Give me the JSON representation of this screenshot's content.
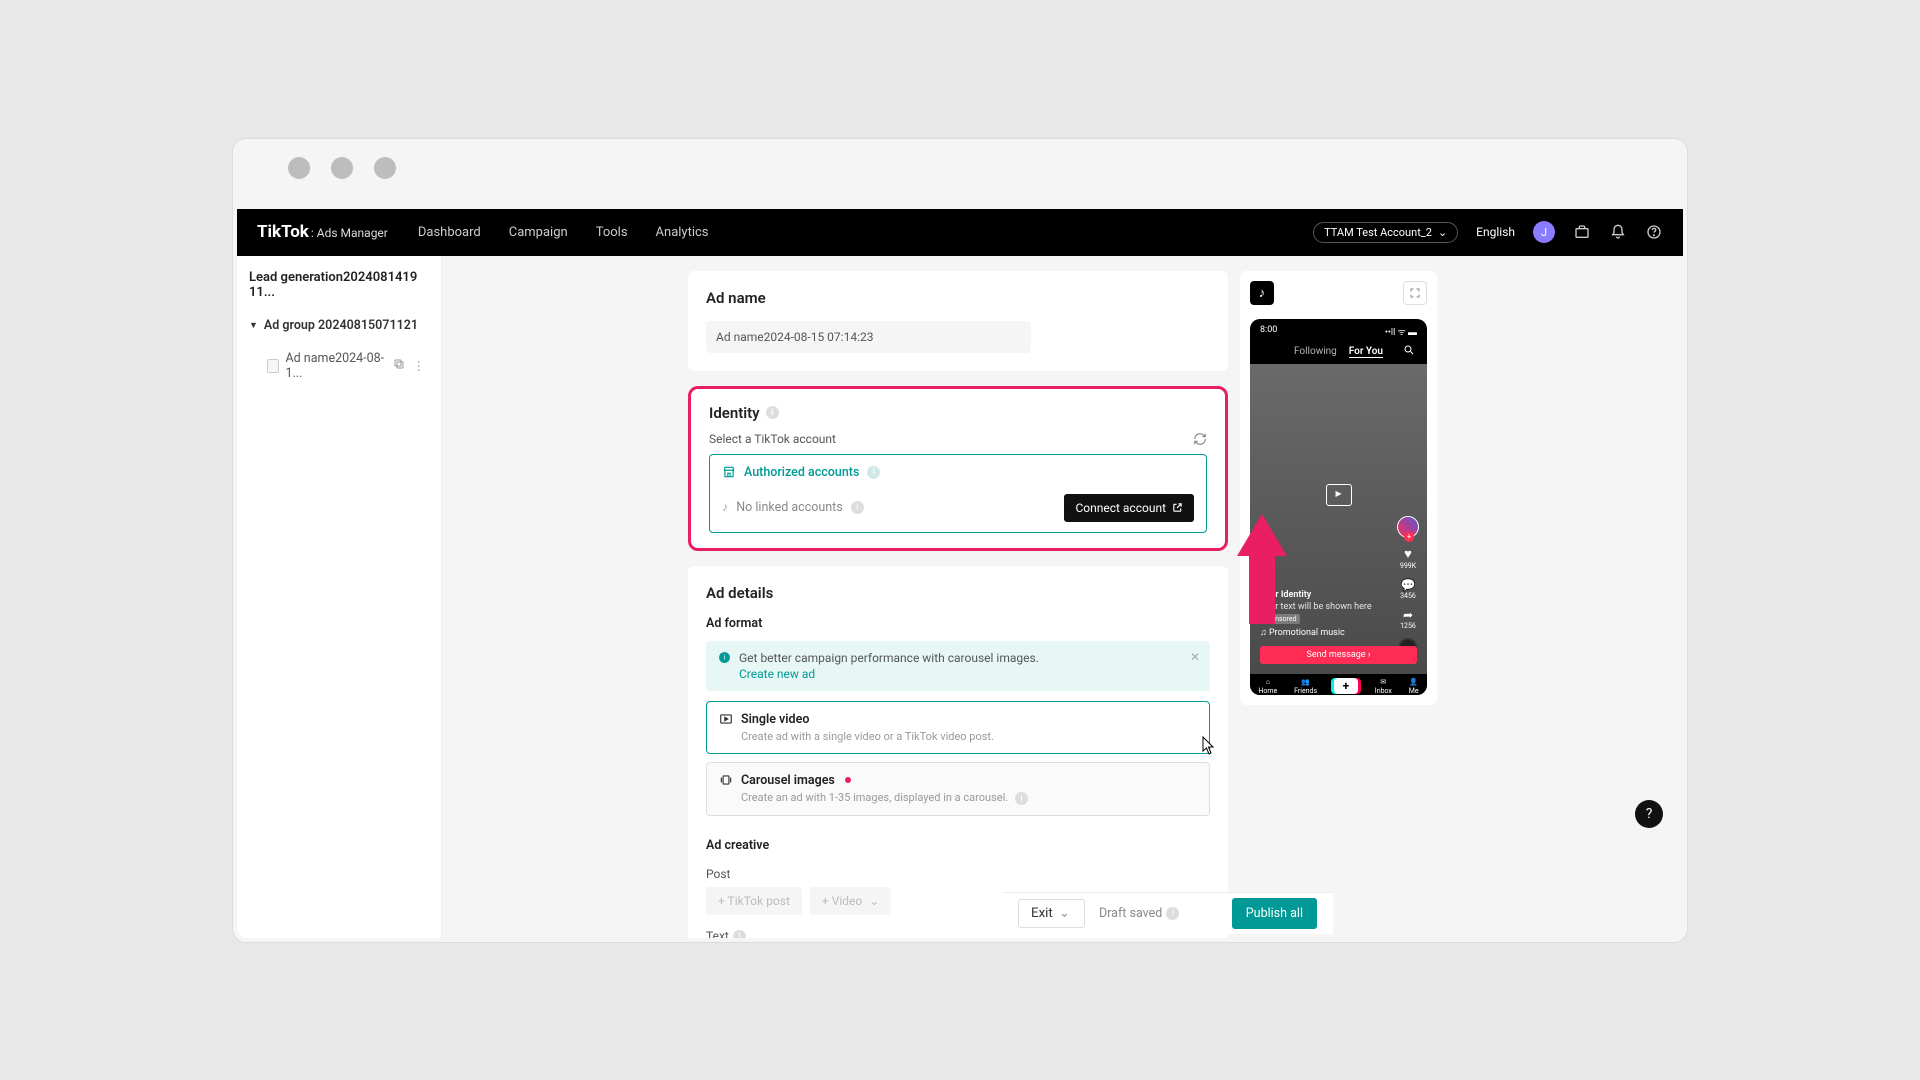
{
  "topnav": {
    "brand": "TikTok",
    "brand_sub": ": Ads Manager",
    "links": [
      "Dashboard",
      "Campaign",
      "Tools",
      "Analytics"
    ],
    "account": "TTAM Test Account_2",
    "language": "English",
    "avatar_initial": "J"
  },
  "sidebar": {
    "campaign": "Lead generation2024081419​11...",
    "adgroup": "Ad group 20240815071121",
    "ad_item": "Ad name2024-08-1..."
  },
  "ad_name": {
    "title": "Ad name",
    "value": "Ad name2024-08-15 07:14:23"
  },
  "identity": {
    "title": "Identity",
    "select_label": "Select a TikTok account",
    "authorized": "Authorized accounts",
    "no_linked": "No linked accounts",
    "connect_btn": "Connect account"
  },
  "ad_details": {
    "title": "Ad details",
    "format_label": "Ad format",
    "banner_text": "Get better campaign performance with carousel images.",
    "banner_link": "Create new ad",
    "single_video_t": "Single video",
    "single_video_d": "Create ad with a single video or a TikTok video post.",
    "carousel_t": "Carousel images",
    "carousel_d": "Create an ad with 1-35 images, displayed in a carousel.",
    "creative_label": "Ad creative",
    "post_label": "Post",
    "tiktok_post_btn": "+ TikTok post",
    "video_btn": "+ Video",
    "text_label": "Text"
  },
  "preview": {
    "time": "8:00",
    "following": "Following",
    "foryou": "For You",
    "likes": "999K",
    "comments": "3456",
    "shares": "1256",
    "identity_line": "Your Identity",
    "text_line": "Your text will be shown here",
    "sponsored": "Sponsored",
    "music": "♫ Promotional music",
    "cta": "Send message ›",
    "tabs": {
      "home": "Home",
      "friends": "Friends",
      "inbox": "Inbox",
      "me": "Me"
    }
  },
  "bottom": {
    "exit": "Exit",
    "draft": "Draft saved",
    "publish": "Publish all"
  }
}
